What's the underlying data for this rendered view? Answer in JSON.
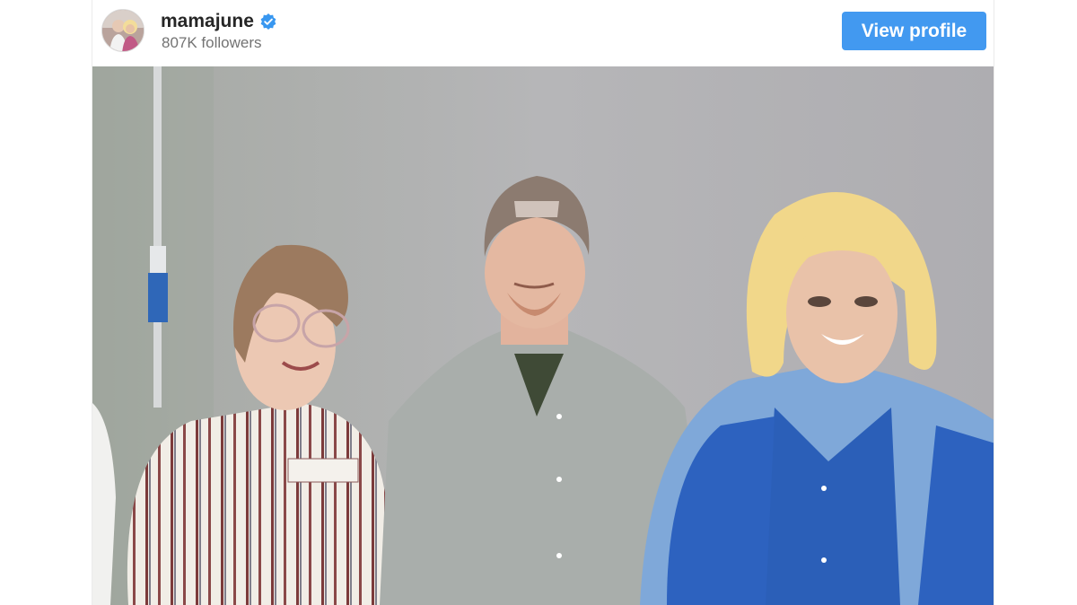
{
  "profile": {
    "username": "mamajune",
    "followers": "807K followers",
    "verified": true,
    "button_label": "View profile"
  },
  "colors": {
    "button": "#4299f0",
    "verified_badge": "#3897f0",
    "username_text": "#262626",
    "followers_text": "#737373"
  },
  "icons": {
    "verified": "verified-badge-icon"
  }
}
